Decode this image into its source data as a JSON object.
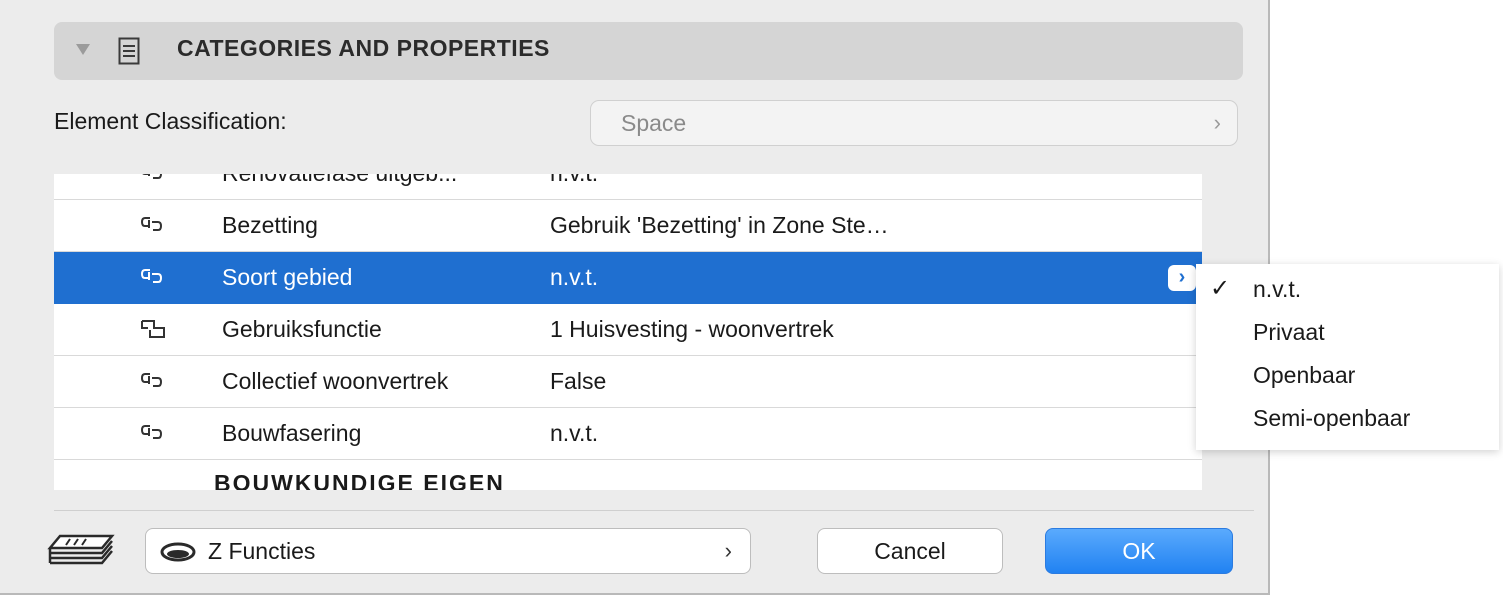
{
  "section": {
    "title": "CATEGORIES AND PROPERTIES"
  },
  "classification": {
    "label": "Element Classification:",
    "value": "Space",
    "chevron": "›"
  },
  "rows": [
    {
      "name": "Renovatiefase uitgeb...",
      "value": "n.v.t.",
      "icon": "link-icon",
      "selected": false
    },
    {
      "name": "Bezetting",
      "value": "Gebruik 'Bezetting' in Zone Ste…",
      "icon": "link-icon",
      "selected": false
    },
    {
      "name": "Soort gebied",
      "value": "n.v.t.",
      "icon": "link-icon",
      "selected": true
    },
    {
      "name": "Gebruiksfunctie",
      "value": "1 Huisvesting - woonvertrek",
      "icon": "step-link-icon",
      "selected": false
    },
    {
      "name": "Collectief woonvertrek",
      "value": "False",
      "icon": "link-icon",
      "selected": false
    },
    {
      "name": "Bouwfasering",
      "value": "n.v.t.",
      "icon": "link-icon",
      "selected": false
    }
  ],
  "row_button": "›",
  "next_group_label": "BOUWKUNDIGE EIGEN",
  "popup": {
    "check": "✓",
    "options": [
      "n.v.t.",
      "Privaat",
      "Openbaar",
      "Semi-openbaar"
    ],
    "selected_index": 0
  },
  "footer": {
    "layer_label": "Z Functies",
    "layer_chevron": "›",
    "cancel_label": "Cancel",
    "ok_label": "OK"
  },
  "colors": {
    "selection": "#1f6fd0",
    "ok_button": "#2182f2",
    "dialog_bg": "#ececec"
  }
}
